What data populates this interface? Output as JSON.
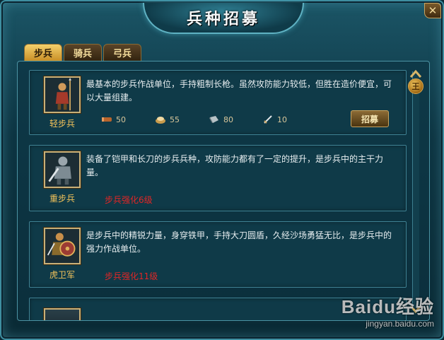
{
  "window": {
    "title": "兵种招募",
    "close_label": "✕"
  },
  "tabs": [
    {
      "label": "步兵",
      "active": true
    },
    {
      "label": "骑兵",
      "active": false
    },
    {
      "label": "弓兵",
      "active": false
    }
  ],
  "units": [
    {
      "name": "轻步兵",
      "description": "最基本的步兵作战单位，手持粗制长枪。虽然攻防能力较低，但胜在造价便宜，可以大量组建。",
      "costs": [
        {
          "icon": "wood-icon",
          "value": "50"
        },
        {
          "icon": "food-icon",
          "value": "55"
        },
        {
          "icon": "iron-icon",
          "value": "80"
        },
        {
          "icon": "sword-icon",
          "value": "10"
        }
      ],
      "recruit_label": "招募"
    },
    {
      "name": "重步兵",
      "description": "装备了铠甲和长刀的步兵兵种，攻防能力都有了一定的提升，是步兵中的主干力量。",
      "requirement": "步兵强化6级"
    },
    {
      "name": "虎卫军",
      "description": "是步兵中的精锐力量，身穿铁甲，手持大刀圆盾，久经沙场勇猛无比，是步兵中的强力作战单位。",
      "requirement": "步兵强化11级"
    }
  ],
  "scrollbar": {
    "thumb_label": "王"
  },
  "watermark": {
    "main": "Baidu经验",
    "sub": "jingyan.baidu.com"
  },
  "colors": {
    "tab_active": "#e8b84a",
    "requirement_text": "#e12626",
    "name_text": "#f3c35a"
  }
}
